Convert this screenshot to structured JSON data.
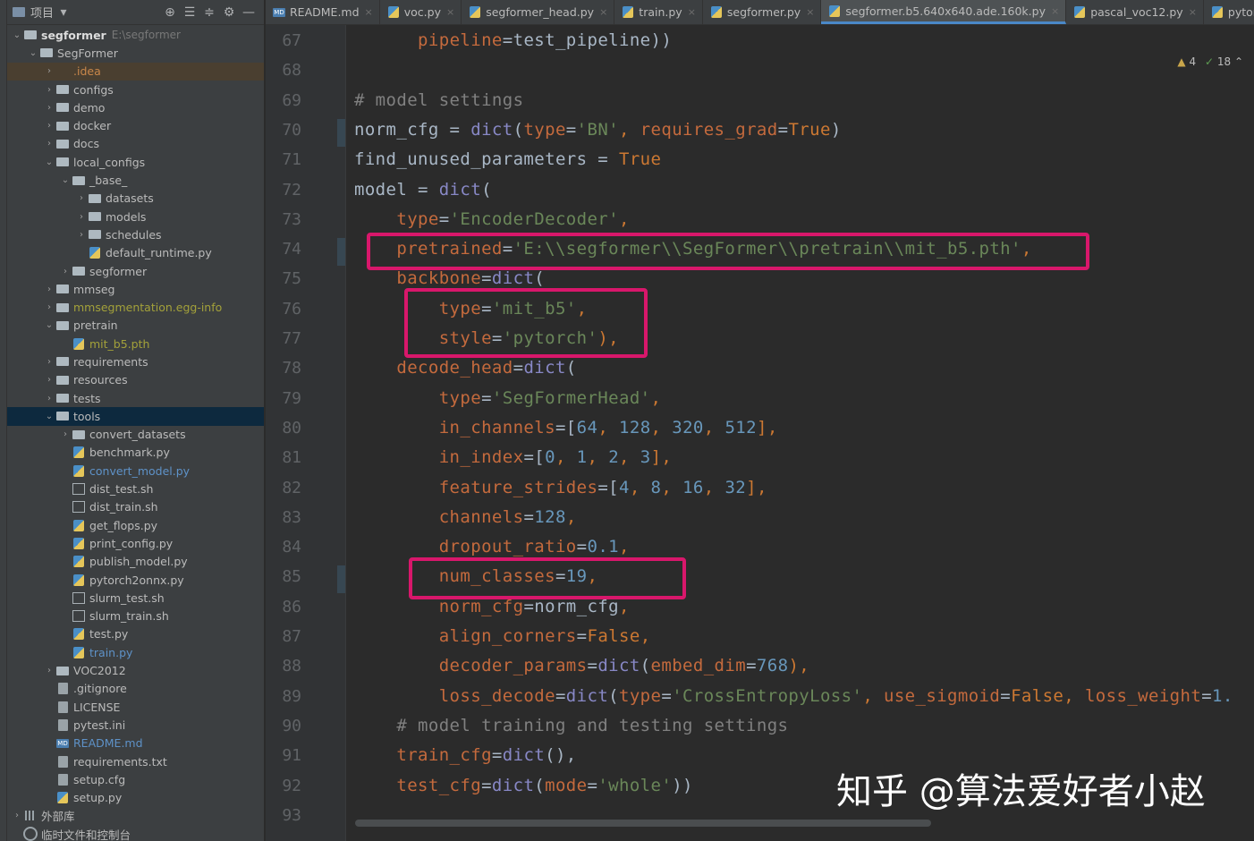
{
  "project_panel": {
    "title": "项目",
    "tree": [
      {
        "depth": 0,
        "arrow": "v",
        "icon": "folder",
        "label": "segformer",
        "style": "bold",
        "path": "E:\\segformer"
      },
      {
        "depth": 1,
        "arrow": "v",
        "icon": "folder",
        "label": "SegFormer",
        "style": "normal"
      },
      {
        "depth": 2,
        "arrow": ">",
        "icon": "folder-o",
        "label": ".idea",
        "style": "orange",
        "hl": "idea"
      },
      {
        "depth": 2,
        "arrow": ">",
        "icon": "folder",
        "label": "configs",
        "style": "normal"
      },
      {
        "depth": 2,
        "arrow": ">",
        "icon": "folder",
        "label": "demo",
        "style": "normal"
      },
      {
        "depth": 2,
        "arrow": ">",
        "icon": "folder",
        "label": "docker",
        "style": "normal"
      },
      {
        "depth": 2,
        "arrow": ">",
        "icon": "folder",
        "label": "docs",
        "style": "normal"
      },
      {
        "depth": 2,
        "arrow": "v",
        "icon": "folder",
        "label": "local_configs",
        "style": "normal"
      },
      {
        "depth": 3,
        "arrow": "v",
        "icon": "folder",
        "label": "_base_",
        "style": "normal"
      },
      {
        "depth": 4,
        "arrow": ">",
        "icon": "folder",
        "label": "datasets",
        "style": "normal"
      },
      {
        "depth": 4,
        "arrow": ">",
        "icon": "folder",
        "label": "models",
        "style": "normal"
      },
      {
        "depth": 4,
        "arrow": ">",
        "icon": "folder",
        "label": "schedules",
        "style": "normal"
      },
      {
        "depth": 4,
        "arrow": "",
        "icon": "py",
        "label": "default_runtime.py",
        "style": "normal"
      },
      {
        "depth": 3,
        "arrow": ">",
        "icon": "folder",
        "label": "segformer",
        "style": "normal"
      },
      {
        "depth": 2,
        "arrow": ">",
        "icon": "folder",
        "label": "mmseg",
        "style": "normal"
      },
      {
        "depth": 2,
        "arrow": ">",
        "icon": "folder",
        "label": "mmsegmentation.egg-info",
        "style": "olive"
      },
      {
        "depth": 2,
        "arrow": "v",
        "icon": "folder",
        "label": "pretrain",
        "style": "normal"
      },
      {
        "depth": 3,
        "arrow": "",
        "icon": "py",
        "label": "mit_b5.pth",
        "style": "olive"
      },
      {
        "depth": 2,
        "arrow": ">",
        "icon": "folder",
        "label": "requirements",
        "style": "normal"
      },
      {
        "depth": 2,
        "arrow": ">",
        "icon": "folder",
        "label": "resources",
        "style": "normal"
      },
      {
        "depth": 2,
        "arrow": ">",
        "icon": "folder",
        "label": "tests",
        "style": "normal"
      },
      {
        "depth": 2,
        "arrow": "v",
        "icon": "folder",
        "label": "tools",
        "style": "normal",
        "hl": "sel"
      },
      {
        "depth": 3,
        "arrow": ">",
        "icon": "folder",
        "label": "convert_datasets",
        "style": "normal"
      },
      {
        "depth": 3,
        "arrow": "",
        "icon": "py",
        "label": "benchmark.py",
        "style": "normal"
      },
      {
        "depth": 3,
        "arrow": "",
        "icon": "py",
        "label": "convert_model.py",
        "style": "blue"
      },
      {
        "depth": 3,
        "arrow": "",
        "icon": "sh",
        "label": "dist_test.sh",
        "style": "normal"
      },
      {
        "depth": 3,
        "arrow": "",
        "icon": "sh",
        "label": "dist_train.sh",
        "style": "normal"
      },
      {
        "depth": 3,
        "arrow": "",
        "icon": "py",
        "label": "get_flops.py",
        "style": "normal"
      },
      {
        "depth": 3,
        "arrow": "",
        "icon": "py",
        "label": "print_config.py",
        "style": "normal"
      },
      {
        "depth": 3,
        "arrow": "",
        "icon": "py",
        "label": "publish_model.py",
        "style": "normal"
      },
      {
        "depth": 3,
        "arrow": "",
        "icon": "py",
        "label": "pytorch2onnx.py",
        "style": "normal"
      },
      {
        "depth": 3,
        "arrow": "",
        "icon": "sh",
        "label": "slurm_test.sh",
        "style": "normal"
      },
      {
        "depth": 3,
        "arrow": "",
        "icon": "sh",
        "label": "slurm_train.sh",
        "style": "normal"
      },
      {
        "depth": 3,
        "arrow": "",
        "icon": "py",
        "label": "test.py",
        "style": "normal"
      },
      {
        "depth": 3,
        "arrow": "",
        "icon": "py",
        "label": "train.py",
        "style": "blue"
      },
      {
        "depth": 2,
        "arrow": ">",
        "icon": "folder",
        "label": "VOC2012",
        "style": "normal"
      },
      {
        "depth": 2,
        "arrow": "",
        "icon": "file",
        "label": ".gitignore",
        "style": "normal"
      },
      {
        "depth": 2,
        "arrow": "",
        "icon": "file",
        "label": "LICENSE",
        "style": "normal"
      },
      {
        "depth": 2,
        "arrow": "",
        "icon": "file",
        "label": "pytest.ini",
        "style": "normal"
      },
      {
        "depth": 2,
        "arrow": "",
        "icon": "md",
        "label": "README.md",
        "style": "blue"
      },
      {
        "depth": 2,
        "arrow": "",
        "icon": "file",
        "label": "requirements.txt",
        "style": "normal"
      },
      {
        "depth": 2,
        "arrow": "",
        "icon": "file",
        "label": "setup.cfg",
        "style": "normal"
      },
      {
        "depth": 2,
        "arrow": "",
        "icon": "py",
        "label": "setup.py",
        "style": "normal"
      },
      {
        "depth": 0,
        "arrow": ">",
        "icon": "lib",
        "label": "外部库",
        "style": "normal"
      },
      {
        "depth": 0,
        "arrow": "",
        "icon": "scratch",
        "label": "临时文件和控制台",
        "style": "normal"
      }
    ]
  },
  "tabs": [
    {
      "label": "README.md",
      "icon": "md",
      "active": false
    },
    {
      "label": "voc.py",
      "icon": "py",
      "active": false
    },
    {
      "label": "segformer_head.py",
      "icon": "py",
      "active": false
    },
    {
      "label": "train.py",
      "icon": "py",
      "active": false
    },
    {
      "label": "segformer.py",
      "icon": "py",
      "active": false
    },
    {
      "label": "segformer.b5.640x640.ade.160k.py",
      "icon": "py",
      "active": true
    },
    {
      "label": "pascal_voc12.py",
      "icon": "py",
      "active": false
    },
    {
      "label": "pytorc",
      "icon": "py",
      "active": false,
      "noclose": true
    }
  ],
  "inspections": {
    "warnings": "4",
    "ok": "18"
  },
  "editor": {
    "lines": [
      {
        "n": "67",
        "tokens": [
          [
            "      ",
            "w"
          ],
          [
            "pipeline",
            "param"
          ],
          [
            "=test_pipeline))",
            "w"
          ]
        ]
      },
      {
        "n": "68",
        "tokens": []
      },
      {
        "n": "69",
        "tokens": [
          [
            "# model settings",
            "com"
          ]
        ]
      },
      {
        "n": "70",
        "tokens": [
          [
            "norm_cfg = ",
            "w"
          ],
          [
            "dict",
            "fn"
          ],
          [
            "(",
            "w"
          ],
          [
            "type",
            "param"
          ],
          [
            "=",
            "w"
          ],
          [
            "'BN'",
            "str"
          ],
          [
            ", ",
            "kw"
          ],
          [
            "requires_grad",
            "param"
          ],
          [
            "=",
            "w"
          ],
          [
            "True",
            "const"
          ],
          [
            ")",
            "w"
          ]
        ]
      },
      {
        "n": "71",
        "tokens": [
          [
            "find_unused_parameters = ",
            "w"
          ],
          [
            "True",
            "const"
          ]
        ]
      },
      {
        "n": "72",
        "tokens": [
          [
            "model = ",
            "w"
          ],
          [
            "dict",
            "fn"
          ],
          [
            "(",
            "w"
          ]
        ]
      },
      {
        "n": "73",
        "tokens": [
          [
            "    ",
            "w"
          ],
          [
            "type",
            "param"
          ],
          [
            "=",
            "w"
          ],
          [
            "'EncoderDecoder'",
            "str"
          ],
          [
            ",",
            "kw"
          ]
        ]
      },
      {
        "n": "74",
        "tokens": [
          [
            "    ",
            "w"
          ],
          [
            "pretrained",
            "param"
          ],
          [
            "=",
            "w"
          ],
          [
            "'E:\\\\segformer\\\\SegFormer\\\\pretrain\\\\mit_b5.pth'",
            "str"
          ],
          [
            ",",
            "kw"
          ]
        ]
      },
      {
        "n": "75",
        "tokens": [
          [
            "    ",
            "w"
          ],
          [
            "backbone",
            "param"
          ],
          [
            "=",
            "w"
          ],
          [
            "dict",
            "fn"
          ],
          [
            "(",
            "w"
          ]
        ]
      },
      {
        "n": "76",
        "tokens": [
          [
            "        ",
            "w"
          ],
          [
            "type",
            "param"
          ],
          [
            "=",
            "w"
          ],
          [
            "'mit_b5'",
            "str"
          ],
          [
            ",",
            "kw"
          ]
        ]
      },
      {
        "n": "77",
        "tokens": [
          [
            "        ",
            "w"
          ],
          [
            "style",
            "param"
          ],
          [
            "=",
            "w"
          ],
          [
            "'pytorch'",
            "str"
          ],
          [
            "),",
            "kw"
          ]
        ]
      },
      {
        "n": "78",
        "tokens": [
          [
            "    ",
            "w"
          ],
          [
            "decode_head",
            "param"
          ],
          [
            "=",
            "w"
          ],
          [
            "dict",
            "fn"
          ],
          [
            "(",
            "w"
          ]
        ]
      },
      {
        "n": "79",
        "tokens": [
          [
            "        ",
            "w"
          ],
          [
            "type",
            "param"
          ],
          [
            "=",
            "w"
          ],
          [
            "'SegFormerHead'",
            "str"
          ],
          [
            ",",
            "kw"
          ]
        ]
      },
      {
        "n": "80",
        "tokens": [
          [
            "        ",
            "w"
          ],
          [
            "in_channels",
            "param"
          ],
          [
            "=[",
            "w"
          ],
          [
            "64",
            "num"
          ],
          [
            ", ",
            "kw"
          ],
          [
            "128",
            "num"
          ],
          [
            ", ",
            "kw"
          ],
          [
            "320",
            "num"
          ],
          [
            ", ",
            "kw"
          ],
          [
            "512",
            "num"
          ],
          [
            "],",
            "kw"
          ]
        ]
      },
      {
        "n": "81",
        "tokens": [
          [
            "        ",
            "w"
          ],
          [
            "in_index",
            "param"
          ],
          [
            "=[",
            "w"
          ],
          [
            "0",
            "num"
          ],
          [
            ", ",
            "kw"
          ],
          [
            "1",
            "num"
          ],
          [
            ", ",
            "kw"
          ],
          [
            "2",
            "num"
          ],
          [
            ", ",
            "kw"
          ],
          [
            "3",
            "num"
          ],
          [
            "],",
            "kw"
          ]
        ]
      },
      {
        "n": "82",
        "tokens": [
          [
            "        ",
            "w"
          ],
          [
            "feature_strides",
            "param"
          ],
          [
            "=[",
            "w"
          ],
          [
            "4",
            "num"
          ],
          [
            ", ",
            "kw"
          ],
          [
            "8",
            "num"
          ],
          [
            ", ",
            "kw"
          ],
          [
            "16",
            "num"
          ],
          [
            ", ",
            "kw"
          ],
          [
            "32",
            "num"
          ],
          [
            "],",
            "kw"
          ]
        ]
      },
      {
        "n": "83",
        "tokens": [
          [
            "        ",
            "w"
          ],
          [
            "channels",
            "param"
          ],
          [
            "=",
            "w"
          ],
          [
            "128",
            "num"
          ],
          [
            ",",
            "kw"
          ]
        ]
      },
      {
        "n": "84",
        "tokens": [
          [
            "        ",
            "w"
          ],
          [
            "dropout_ratio",
            "param"
          ],
          [
            "=",
            "w"
          ],
          [
            "0.1",
            "num"
          ],
          [
            ",",
            "kw"
          ]
        ]
      },
      {
        "n": "85",
        "tokens": [
          [
            "        ",
            "w"
          ],
          [
            "num_classes",
            "param"
          ],
          [
            "=",
            "w"
          ],
          [
            "19",
            "num"
          ],
          [
            ",",
            "kw"
          ]
        ]
      },
      {
        "n": "86",
        "tokens": [
          [
            "        ",
            "w"
          ],
          [
            "norm_cfg",
            "param"
          ],
          [
            "=norm_cfg",
            ""
          ],
          [
            ",",
            "kw"
          ]
        ]
      },
      {
        "n": "87",
        "tokens": [
          [
            "        ",
            "w"
          ],
          [
            "align_corners",
            "param"
          ],
          [
            "=",
            "w"
          ],
          [
            "False",
            "const"
          ],
          [
            ",",
            "kw"
          ]
        ]
      },
      {
        "n": "88",
        "tokens": [
          [
            "        ",
            "w"
          ],
          [
            "decoder_params",
            "param"
          ],
          [
            "=",
            "w"
          ],
          [
            "dict",
            "fn"
          ],
          [
            "(",
            "w"
          ],
          [
            "embed_dim",
            "param"
          ],
          [
            "=",
            "w"
          ],
          [
            "768",
            "num"
          ],
          [
            "),",
            "kw"
          ]
        ]
      },
      {
        "n": "89",
        "tokens": [
          [
            "        ",
            "w"
          ],
          [
            "loss_decode",
            "param"
          ],
          [
            "=",
            "w"
          ],
          [
            "dict",
            "fn"
          ],
          [
            "(",
            "w"
          ],
          [
            "type",
            "param"
          ],
          [
            "=",
            "w"
          ],
          [
            "'CrossEntropyLoss'",
            "str"
          ],
          [
            ", ",
            "kw"
          ],
          [
            "use_sigmoid",
            "param"
          ],
          [
            "=",
            "w"
          ],
          [
            "False",
            "const"
          ],
          [
            ", ",
            "kw"
          ],
          [
            "loss_weight",
            "param"
          ],
          [
            "=",
            "w"
          ],
          [
            "1.",
            "num"
          ]
        ]
      },
      {
        "n": "90",
        "tokens": [
          [
            "    ",
            "w"
          ],
          [
            "# model training and testing settings",
            "com"
          ]
        ]
      },
      {
        "n": "91",
        "tokens": [
          [
            "    ",
            "w"
          ],
          [
            "train_cfg",
            "param"
          ],
          [
            "=",
            "w"
          ],
          [
            "dict",
            "fn"
          ],
          [
            "(),",
            "w"
          ]
        ]
      },
      {
        "n": "92",
        "tokens": [
          [
            "    ",
            "w"
          ],
          [
            "test_cfg",
            "param"
          ],
          [
            "=",
            "w"
          ],
          [
            "dict",
            "fn"
          ],
          [
            "(",
            "w"
          ],
          [
            "mode",
            "param"
          ],
          [
            "=",
            "w"
          ],
          [
            "'whole'",
            "str"
          ],
          [
            "))",
            "w"
          ]
        ]
      },
      {
        "n": "93",
        "tokens": []
      }
    ]
  },
  "watermark": "知乎 @算法爱好者小赵",
  "colors": {
    "highlight_box": "#d8176b",
    "editor_bg": "#2b2b2b",
    "panel_bg": "#3c3f41",
    "active_tab_underline": "#4a88c7"
  }
}
